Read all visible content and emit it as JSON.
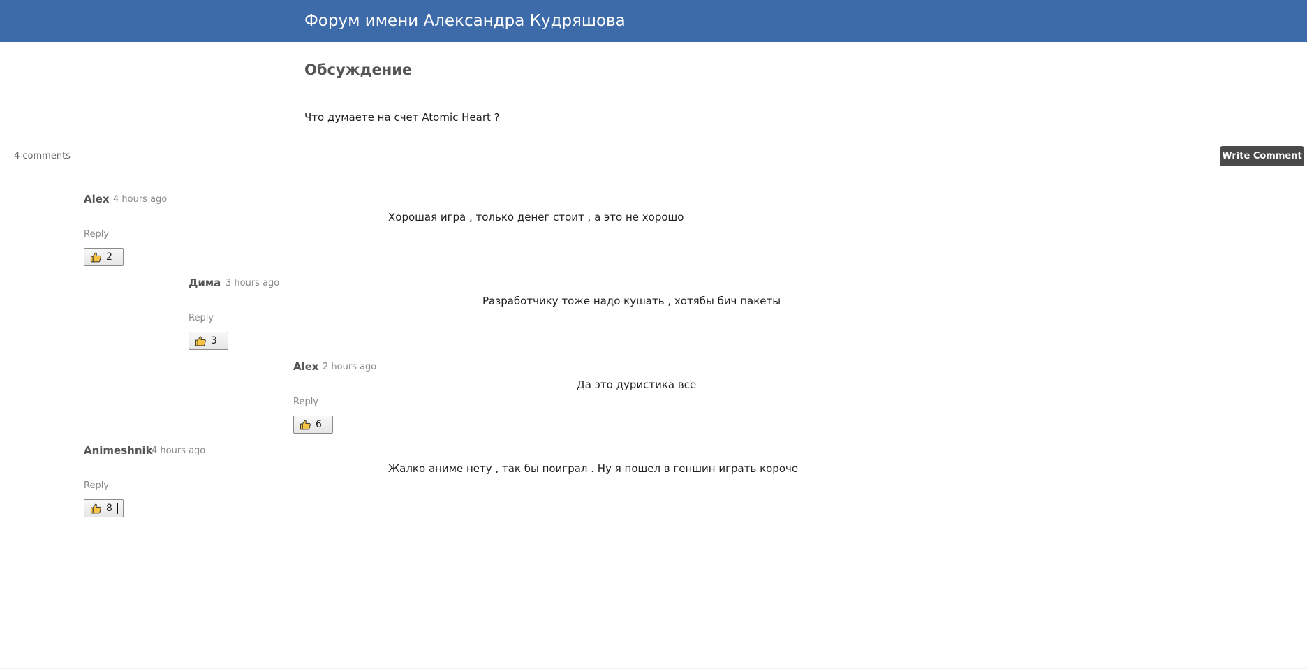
{
  "header": {
    "site_title": "Форум имени Александра Кудряшова",
    "background_color": "#3d6aa9"
  },
  "topic": {
    "heading": "Обсуждение",
    "question": "Что думаете на счет Atomic Heart ?"
  },
  "comments_bar": {
    "count_label": "4 comments",
    "write_button_label": "Write Comment"
  },
  "comments": [
    {
      "author": "Alex",
      "time": "4 hours ago",
      "text": "Хорошая игра , только денег стоит , а это не хорошо",
      "reply_label": "Reply",
      "likes": "2",
      "depth": 0
    },
    {
      "author": "Дима",
      "time": "3 hours ago",
      "text": "Разработчику тоже надо кушать , хотябы бич пакеты",
      "reply_label": "Reply",
      "likes": "3",
      "depth": 1
    },
    {
      "author": "Alex",
      "time": "2 hours ago",
      "text": "Да это дуристика все",
      "reply_label": "Reply",
      "likes": "6",
      "depth": 2
    },
    {
      "author": "Animeshnik",
      "time": "4 hours ago",
      "text": "Жалко аниме нету , так бы поиграл . Ну я пошел в геншин играть короче",
      "reply_label": "Reply",
      "likes": "8",
      "depth": 0
    }
  ],
  "icons": {
    "like": "thumbs-up-icon"
  }
}
